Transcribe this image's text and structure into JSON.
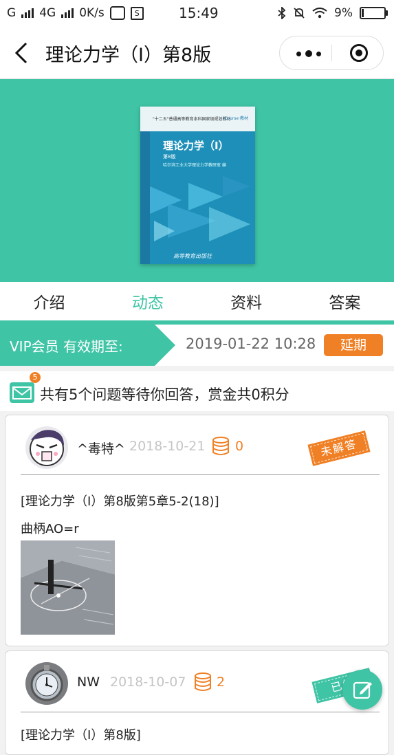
{
  "status_bar": {
    "carrier_left": "G",
    "network": "4G",
    "speed": "0K/s",
    "time": "15:49",
    "battery": "9%"
  },
  "nav": {
    "title": "理论力学（Ⅰ）第8版"
  },
  "book_cover": {
    "series_text": "\"十二五\"普通高等教育本科国家级规划教材",
    "logo_text": "iCourse·教材",
    "title": "理论力学（Ⅰ）",
    "edition": "第8版",
    "author": "哈尔滨工业大学理论力学教研室 编",
    "publisher": "高等教育出版社"
  },
  "tabs": [
    {
      "label": "介绍",
      "active": false
    },
    {
      "label": "动态",
      "active": true
    },
    {
      "label": "资料",
      "active": false
    },
    {
      "label": "答案",
      "active": false
    }
  ],
  "vip": {
    "label": "VIP会员 有效期至:",
    "expiry": "2019-01-22 10:28",
    "renew_label": "延期"
  },
  "notice": {
    "badge_count": "5",
    "text": "共有5个问题等待你回答，赏金共0积分"
  },
  "posts": [
    {
      "username": "^毒特^",
      "date": "2018-10-21",
      "points": "0",
      "status": "未解答",
      "title": "[理论力学（Ⅰ）第8版第5章5-2(18)]",
      "body": "曲柄AO=r"
    },
    {
      "username": "NW",
      "date": "2018-10-07",
      "points": "2",
      "status": "已解",
      "title": "[理论力学（Ⅰ）第8版]"
    }
  ],
  "colors": {
    "accent": "#3fc4a5",
    "orange": "#f08025"
  }
}
